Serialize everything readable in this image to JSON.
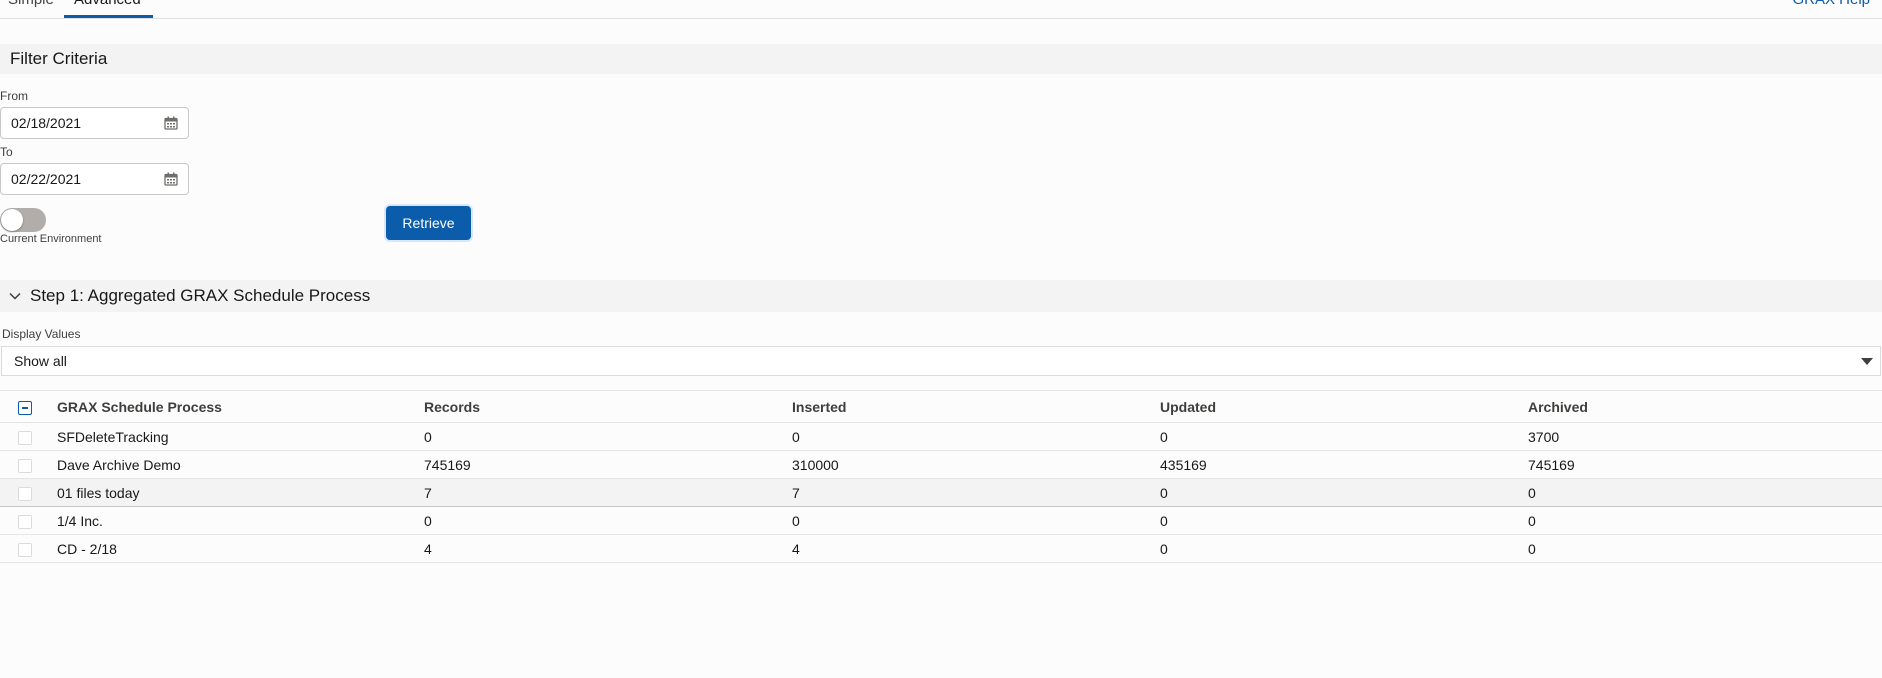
{
  "tabs": {
    "simple": "Simple",
    "advanced": "Advanced",
    "help_link": "GRAX Help"
  },
  "filter": {
    "title": "Filter Criteria",
    "from_label": "From",
    "from_value": "02/18/2021",
    "to_label": "To",
    "to_value": "02/22/2021",
    "toggle_label": "Current Environment",
    "toggle_on": false,
    "retrieve_label": "Retrieve"
  },
  "step1": {
    "title": "Step 1: Aggregated GRAX Schedule Process",
    "display_label": "Display Values",
    "display_value": "Show all"
  },
  "table": {
    "columns": [
      "GRAX Schedule Process",
      "Records",
      "Inserted",
      "Updated",
      "Archived"
    ],
    "rows": [
      {
        "name": "SFDeleteTracking",
        "records": "0",
        "inserted": "0",
        "updated": "0",
        "archived": "3700"
      },
      {
        "name": "Dave Archive Demo",
        "records": "745169",
        "inserted": "310000",
        "updated": "435169",
        "archived": "745169"
      },
      {
        "name": "01 files today",
        "records": "7",
        "inserted": "7",
        "updated": "0",
        "archived": "0"
      },
      {
        "name": "1/4 Inc.",
        "records": "0",
        "inserted": "0",
        "updated": "0",
        "archived": "0"
      },
      {
        "name": "CD - 2/18",
        "records": "4",
        "inserted": "4",
        "updated": "0",
        "archived": "0"
      }
    ]
  },
  "colors": {
    "brand": "#0b5cab",
    "section_bg": "#f3f3f3",
    "toggle_off": "#b0adab"
  },
  "icons": {
    "calendar": "calendar-icon",
    "chevron": "chevron-down-icon",
    "caret": "caret-down-icon"
  }
}
